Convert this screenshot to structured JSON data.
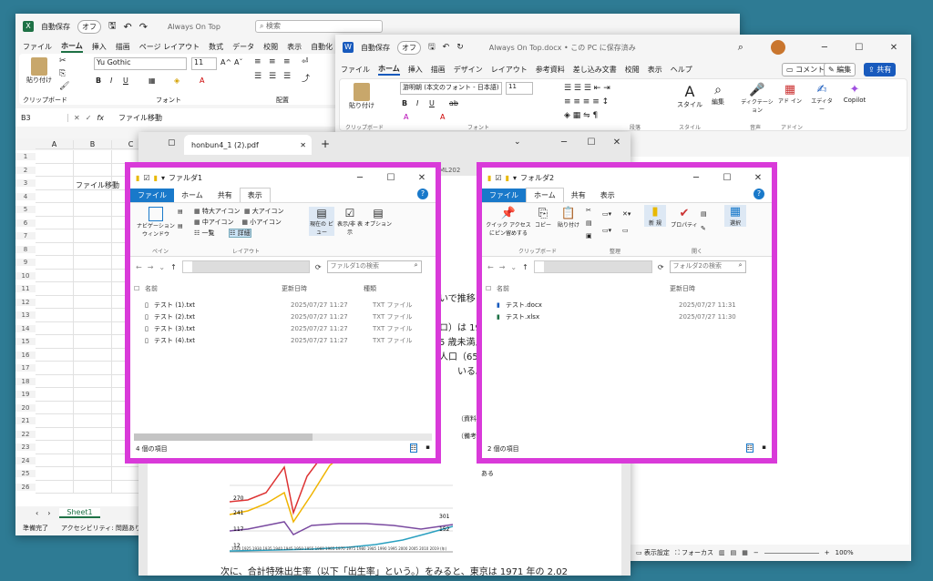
{
  "excel": {
    "autosave": "自動保存",
    "autosave_state": "オフ",
    "doc_title": "Always On Top",
    "search": "検索",
    "menu": [
      "ファイル",
      "ホーム",
      "挿入",
      "描画",
      "ページ レイアウト",
      "数式",
      "データ",
      "校閲",
      "表示",
      "自動化"
    ],
    "font_name": "Yu Gothic",
    "font_size": "11",
    "grp_clipboard": "クリップボード",
    "grp_font": "フォント",
    "grp_align": "配置",
    "paste": "貼り付け",
    "namebox": "B3",
    "fx": "fx",
    "formula": "ファイル移動",
    "cols": [
      "A",
      "B",
      "C"
    ],
    "rows": [
      "1",
      "2",
      "3",
      "4",
      "5",
      "6",
      "7",
      "8",
      "9",
      "10",
      "11",
      "12",
      "13",
      "14",
      "15",
      "16",
      "17",
      "18",
      "19",
      "20",
      "21",
      "22",
      "23",
      "24",
      "25",
      "26"
    ],
    "b3": "ファイル移動",
    "sheet": "Sheet1",
    "status": "準備完了",
    "access": "アクセシビリティ: 問題あり"
  },
  "word": {
    "autosave": "自動保存",
    "autosave_state": "オフ",
    "doc_title": "Always On Top.docx • この PC に保存済み",
    "menu": [
      "ファイル",
      "ホーム",
      "挿入",
      "描画",
      "デザイン",
      "レイアウト",
      "参考資料",
      "差し込み文書",
      "校閲",
      "表示",
      "ヘルプ"
    ],
    "comment": "コメント",
    "edit": "編集",
    "share": "共有",
    "font_name": "游明朝 (本文のフォント - 日本語)",
    "font_size": "11",
    "paste": "貼り付け",
    "style": "スタイル",
    "editing": "編集",
    "dictation": "ディクテーション",
    "addin": "アド イン",
    "editor": "エディター",
    "copilot": "Copilot",
    "grp": [
      "クリップボード",
      "フォント",
      "段落",
      "スタイル",
      "音声",
      "アドイン"
    ],
    "status_display": "表示設定",
    "status_focus": "フォーカス",
    "zoom": "100%"
  },
  "pdf": {
    "tab": "honbun4_1 (2).pdf",
    "partial_tab": "ML202",
    "frag": [
      "いで推移し",
      "ロ）は 19",
      "5 歳未満人",
      "人口（65",
      "いる。"
    ],
    "src": "（資料）",
    "note": "（備考）",
    "note2": "ある",
    "bottom": "次に、合計特殊出生率（以下「出生率」という。）をみると、東京は 1971 年の 2.02",
    "labels": {
      "a": "270",
      "b": "241",
      "c": "117",
      "d": "12",
      "e": "301",
      "f": "152"
    },
    "xaxis": "1920 1925 1930 1935 1940 1945 1950 1955 1960 1965 1970 1975 1980 1985 1990 1995 2000 2005 2010 2019 (年)"
  },
  "folder1": {
    "title": "ファルダ1",
    "tabs": [
      "ファイル",
      "ホーム",
      "共有",
      "表示"
    ],
    "ribbon": {
      "nav": "ナビゲーション ウィンドウ",
      "pane": "ペイン",
      "xl": "特大アイコン",
      "l": "大アイコン",
      "m": "中アイコン",
      "s": "小アイコン",
      "list": "一覧",
      "detail": "詳細",
      "layout": "レイアウト",
      "current": "現在の ビュー",
      "showhide": "表示/非 表示",
      "option": "オプション"
    },
    "search": "ファルダ1の検索",
    "col_name": "名前",
    "col_date": "更新日時",
    "col_type": "種類",
    "files": [
      {
        "name": "テスト (1).txt",
        "date": "2025/07/27 11:27",
        "type": "TXT ファイル"
      },
      {
        "name": "テスト (2).txt",
        "date": "2025/07/27 11:27",
        "type": "TXT ファイル"
      },
      {
        "name": "テスト (3).txt",
        "date": "2025/07/27 11:27",
        "type": "TXT ファイル"
      },
      {
        "name": "テスト (4).txt",
        "date": "2025/07/27 11:27",
        "type": "TXT ファイル"
      }
    ],
    "count": "4 個の項目"
  },
  "folder2": {
    "title": "フォルダ2",
    "tabs": [
      "ファイル",
      "ホーム",
      "共有",
      "表示"
    ],
    "ribbon": {
      "quick": "クイック アクセス にピン留めする",
      "copy": "コピー",
      "paste": "貼り付け",
      "new": "新 規",
      "prop": "プロパティ",
      "select": "選択",
      "clip": "クリップボード",
      "org": "整理",
      "open": "開く"
    },
    "search": "フォルダ2の検索",
    "col_name": "名前",
    "col_date": "更新日時",
    "files": [
      {
        "name": "テスト.docx",
        "date": "2025/07/27 11:31"
      },
      {
        "name": "テスト.xlsx",
        "date": "2025/07/27 11:30"
      }
    ],
    "count": "2 個の項目"
  },
  "colors": {
    "border": "#d93ad9",
    "excel_green": "#1e7145",
    "word_blue": "#185abd",
    "explorer_blue": "#1979ca"
  }
}
